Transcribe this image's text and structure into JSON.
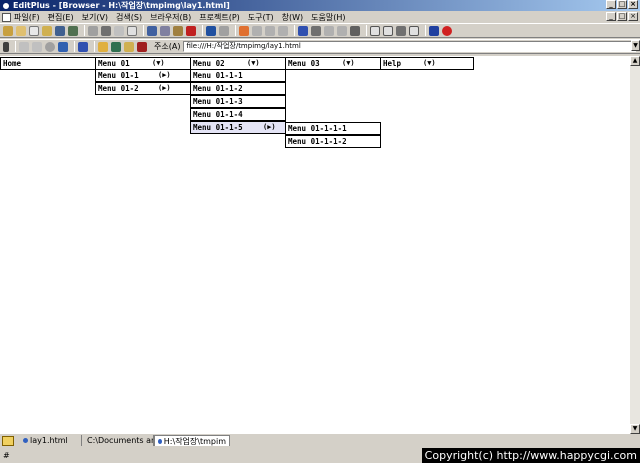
{
  "window": {
    "title": "EditPlus - [Browser - H:\\작업장\\tmpimg\\lay1.html]",
    "controls": [
      "_",
      "□",
      "×"
    ]
  },
  "menubar": {
    "items": [
      "파일(F)",
      "편집(E)",
      "보기(V)",
      "검색(S)",
      "브라우저(B)",
      "프로젝트(P)",
      "도구(T)",
      "창(W)",
      "도움말(H)"
    ]
  },
  "addressbar": {
    "label": "주소(A)",
    "value": "file:///H:/작업장/tmpimg/lay1.html"
  },
  "page_menu": {
    "top": [
      {
        "label": "Home",
        "arrow": ""
      },
      {
        "label": "Menu 01",
        "arrow": "(▼)"
      },
      {
        "label": "Menu 02",
        "arrow": "(▼)"
      },
      {
        "label": "Menu 03",
        "arrow": "(▼)"
      },
      {
        "label": "Help",
        "arrow": "(▼)"
      }
    ],
    "menu01": [
      {
        "label": "Menu 01-1",
        "arrow": "(▶)"
      },
      {
        "label": "Menu 01-2",
        "arrow": "(▶)"
      }
    ],
    "menu01_1": [
      {
        "label": "Menu 01-1-1"
      },
      {
        "label": "Menu 01-1-2"
      },
      {
        "label": "Menu 01-1-3"
      },
      {
        "label": "Menu 01-1-4"
      },
      {
        "label": "Menu 01-1-5",
        "arrow": "(▶)"
      }
    ],
    "menu01_1_5": [
      {
        "label": "Menu 01-1-1-1"
      },
      {
        "label": "Menu 01-1-1-2"
      }
    ]
  },
  "tabs": [
    {
      "label": "lay1.html"
    },
    {
      "label": "C:\\Documents an"
    },
    {
      "label": "H:\\작업장\\tmpim"
    }
  ],
  "status": {
    "left": "#",
    "copyright": "Copyright(c) http://www.happycgi.com"
  },
  "colors": {
    "title_start": "#0a246a",
    "title_end": "#a6caf0",
    "highlight": "#e4e4f6",
    "chrome": "#d4d0c8"
  }
}
